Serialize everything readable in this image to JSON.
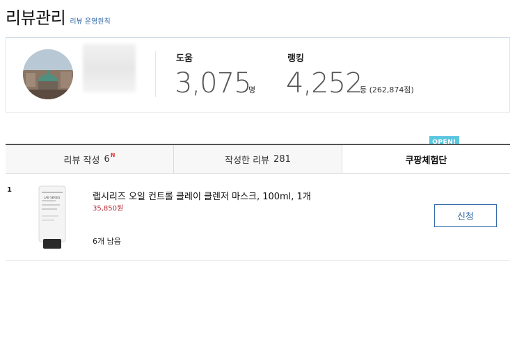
{
  "header": {
    "title": "리뷰관리",
    "policy_link": "리뷰 운영원칙"
  },
  "profile": {
    "help": {
      "label": "도움",
      "value": "3,075",
      "unit": "명"
    },
    "rank": {
      "label": "랭킹",
      "value": "4,252",
      "unit": "등 (262,874점)"
    }
  },
  "tabs": [
    {
      "label": "리뷰 작성",
      "count": "6",
      "badge": "N"
    },
    {
      "label": "작성한 리뷰",
      "count": "281"
    },
    {
      "label": "쿠팡체험단",
      "badge_open": "OPEN!"
    }
  ],
  "items": [
    {
      "index": "1",
      "title": "랩시리즈 오일 컨트롤 클레이 클렌저 마스크, 100ml, 1개",
      "price": "35,850원",
      "remaining": "6개 남음",
      "action": "신청",
      "thumb_brand": "LAB SERIES"
    }
  ]
}
